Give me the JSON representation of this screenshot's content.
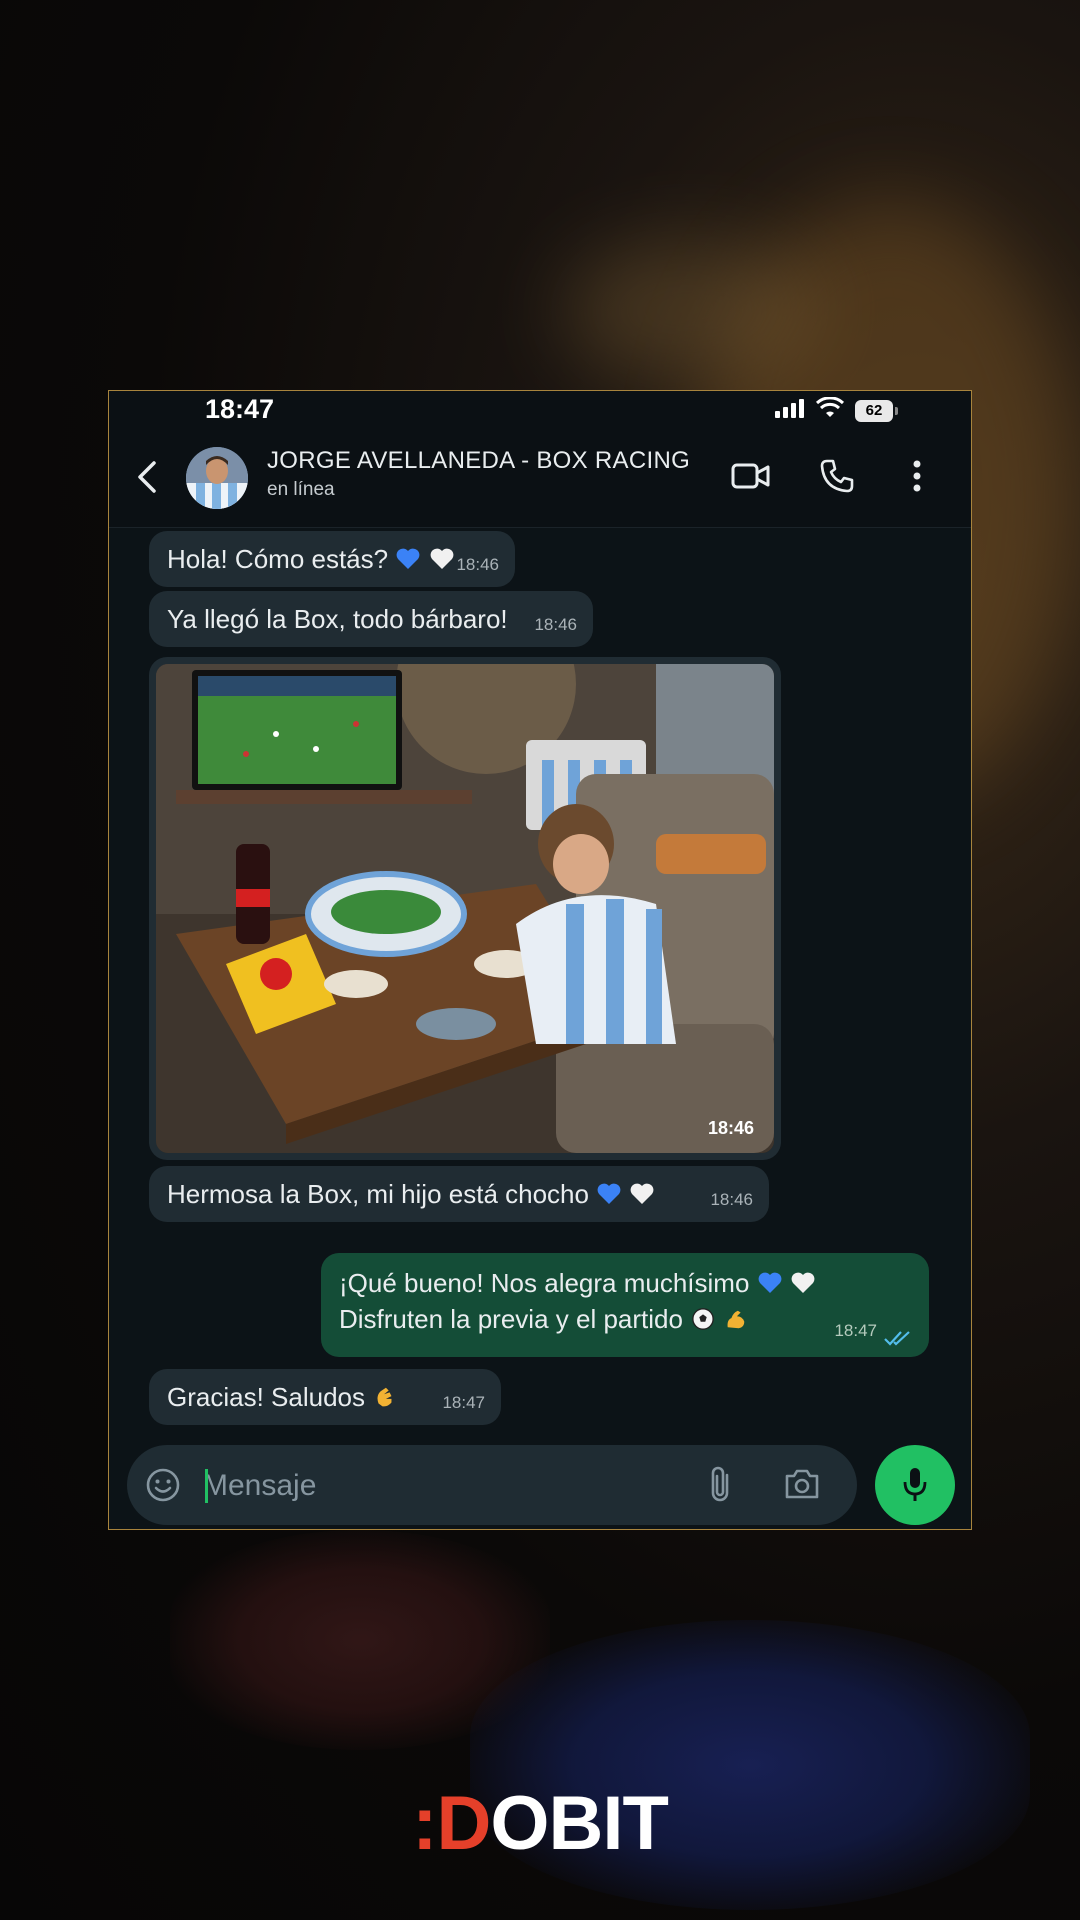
{
  "status_bar": {
    "time": "18:47",
    "battery": "62"
  },
  "header": {
    "contact_name": "JORGE AVELLANEDA - BOX RACING",
    "contact_status": "en línea",
    "icons": [
      "back-arrow-icon",
      "video-call-icon",
      "phone-icon",
      "more-vert-icon"
    ]
  },
  "messages": [
    {
      "direction": "in",
      "text": "Hola! Cómo estás?",
      "emoji": [
        "blue-heart",
        "white-heart"
      ],
      "time": "18:46"
    },
    {
      "direction": "in",
      "text": "Ya llegó la Box, todo bárbaro!",
      "time": "18:46"
    },
    {
      "direction": "in",
      "type": "image",
      "time": "18:46"
    },
    {
      "direction": "in",
      "text": "Hermosa la Box, mi hijo está chocho",
      "emoji": [
        "blue-heart",
        "white-heart"
      ],
      "time": "18:46"
    },
    {
      "direction": "out",
      "line1": "¡Qué bueno! Nos alegra muchísimo",
      "line2": "Disfruten la previa y el partido",
      "emoji1": [
        "blue-heart",
        "white-heart"
      ],
      "emoji2": [
        "soccer-ball",
        "flexed-biceps"
      ],
      "time": "18:47",
      "read_status": "read"
    },
    {
      "direction": "in",
      "text": "Gracias! Saludos",
      "emoji": [
        "clapping-hands"
      ],
      "time": "18:47"
    }
  ],
  "composer": {
    "placeholder": "Mensaje",
    "value": ""
  },
  "brand": {
    "prefix": ":",
    "first": "D",
    "rest": "OBIT"
  },
  "colors": {
    "incoming_bubble": "#202c33",
    "outgoing_bubble": "#144d37",
    "accent_green": "#21c063",
    "read_ticks": "#53bdeb",
    "brand_red": "#e5402a",
    "frame_border": "#a8843d"
  }
}
